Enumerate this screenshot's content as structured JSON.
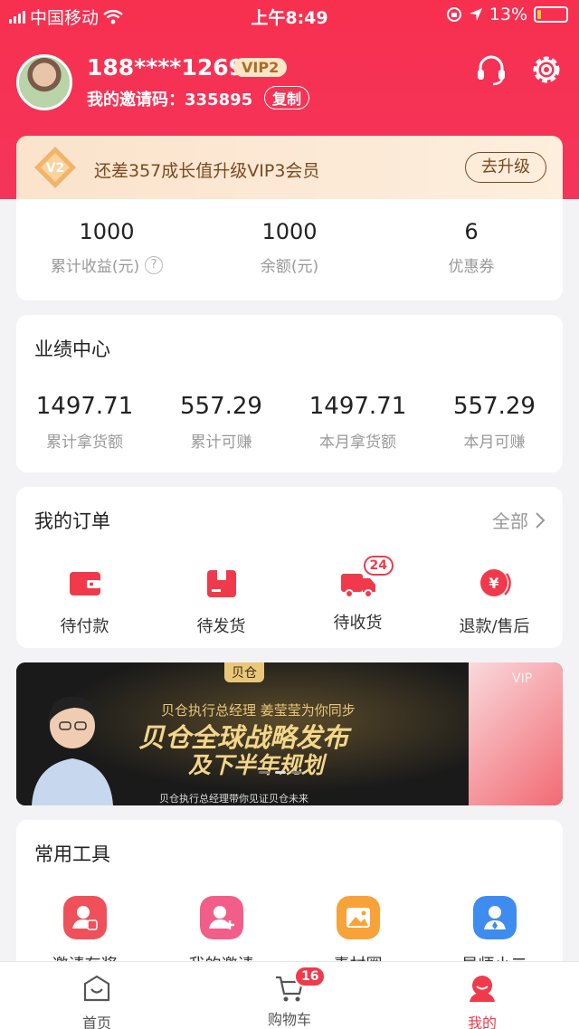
{
  "status_bar": {
    "carrier": "中国移动",
    "time": "上午8:49",
    "battery": "13%",
    "battery_level": 0.13
  },
  "profile": {
    "phone": "188****1269",
    "vip_level": "VIP2",
    "invite_label": "我的邀请码：",
    "invite_code": "335895",
    "copy_label": "复制"
  },
  "upgrade": {
    "badge": "V2",
    "text": "还差357成长值升级VIP3会员",
    "button": "去升级"
  },
  "stats": [
    {
      "value": "1000",
      "label": "累计收益(元)",
      "help": "?"
    },
    {
      "value": "1000",
      "label": "余额(元)"
    },
    {
      "value": "6",
      "label": "优惠券"
    }
  ],
  "performance": {
    "title": "业绩中心",
    "items": [
      {
        "value": "1497.71",
        "label": "累计拿货额"
      },
      {
        "value": "557.29",
        "label": "累计可赚"
      },
      {
        "value": "1497.71",
        "label": "本月拿货额"
      },
      {
        "value": "557.29",
        "label": "本月可赚"
      }
    ]
  },
  "orders": {
    "title": "我的订单",
    "all": "全部",
    "items": [
      {
        "label": "待付款",
        "icon": "wallet-icon"
      },
      {
        "label": "待发货",
        "icon": "package-icon"
      },
      {
        "label": "待收货",
        "icon": "truck-icon",
        "badge": "24"
      },
      {
        "label": "退款/售后",
        "icon": "refund-icon"
      }
    ]
  },
  "banner": {
    "tag": "贝仓",
    "subtitle": "贝仓执行总经理 姜莹莹为你同步",
    "headline1": "贝仓全球战略发布",
    "headline2": "及下半年规划",
    "footer": "贝仓执行总经理带你见证贝仓未来",
    "side_tag": "VIP"
  },
  "tools": {
    "title": "常用工具",
    "items": [
      {
        "label": "邀请有奖",
        "color": "#f0505a"
      },
      {
        "label": "我的邀请",
        "color": "#f25d8a"
      },
      {
        "label": "素材圈",
        "color": "#f8a23a"
      },
      {
        "label": "导师小二",
        "color": "#3f8cf0"
      }
    ]
  },
  "tabbar": [
    {
      "label": "首页"
    },
    {
      "label": "购物车",
      "badge": "16"
    },
    {
      "label": "我的"
    }
  ],
  "colors": {
    "brand": "#f5345b",
    "accent": "#f03a4c",
    "gold": "#e9c77a"
  }
}
